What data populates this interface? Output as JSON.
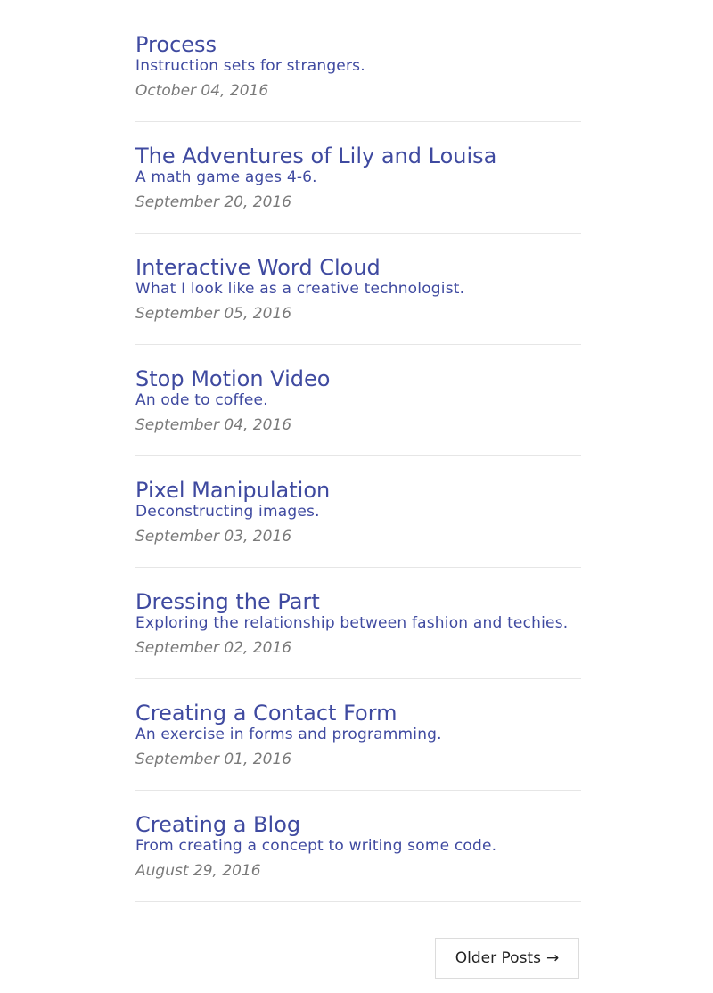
{
  "posts": [
    {
      "title": "Process",
      "subtitle": "Instruction sets for strangers.",
      "date": "October 04, 2016"
    },
    {
      "title": "The Adventures of Lily and Louisa",
      "subtitle": "A math game ages 4-6.",
      "date": "September 20, 2016"
    },
    {
      "title": "Interactive Word Cloud",
      "subtitle": "What I look like as a creative technologist.",
      "date": "September 05, 2016"
    },
    {
      "title": "Stop Motion Video",
      "subtitle": "An ode to coffee.",
      "date": "September 04, 2016"
    },
    {
      "title": "Pixel Manipulation",
      "subtitle": "Deconstructing images.",
      "date": "September 03, 2016"
    },
    {
      "title": "Dressing the Part",
      "subtitle": "Exploring the relationship between fashion and techies.",
      "date": "September 02, 2016"
    },
    {
      "title": "Creating a Contact Form",
      "subtitle": "An exercise in forms and programming.",
      "date": "September 01, 2016"
    },
    {
      "title": "Creating a Blog",
      "subtitle": "From creating a concept to writing some code.",
      "date": "August 29, 2016"
    }
  ],
  "pager": {
    "label": "Older Posts",
    "arrow": "→"
  },
  "colors": {
    "link": "#3f4aa0",
    "meta": "#7a7a7a",
    "divider": "#e6e6e6"
  }
}
